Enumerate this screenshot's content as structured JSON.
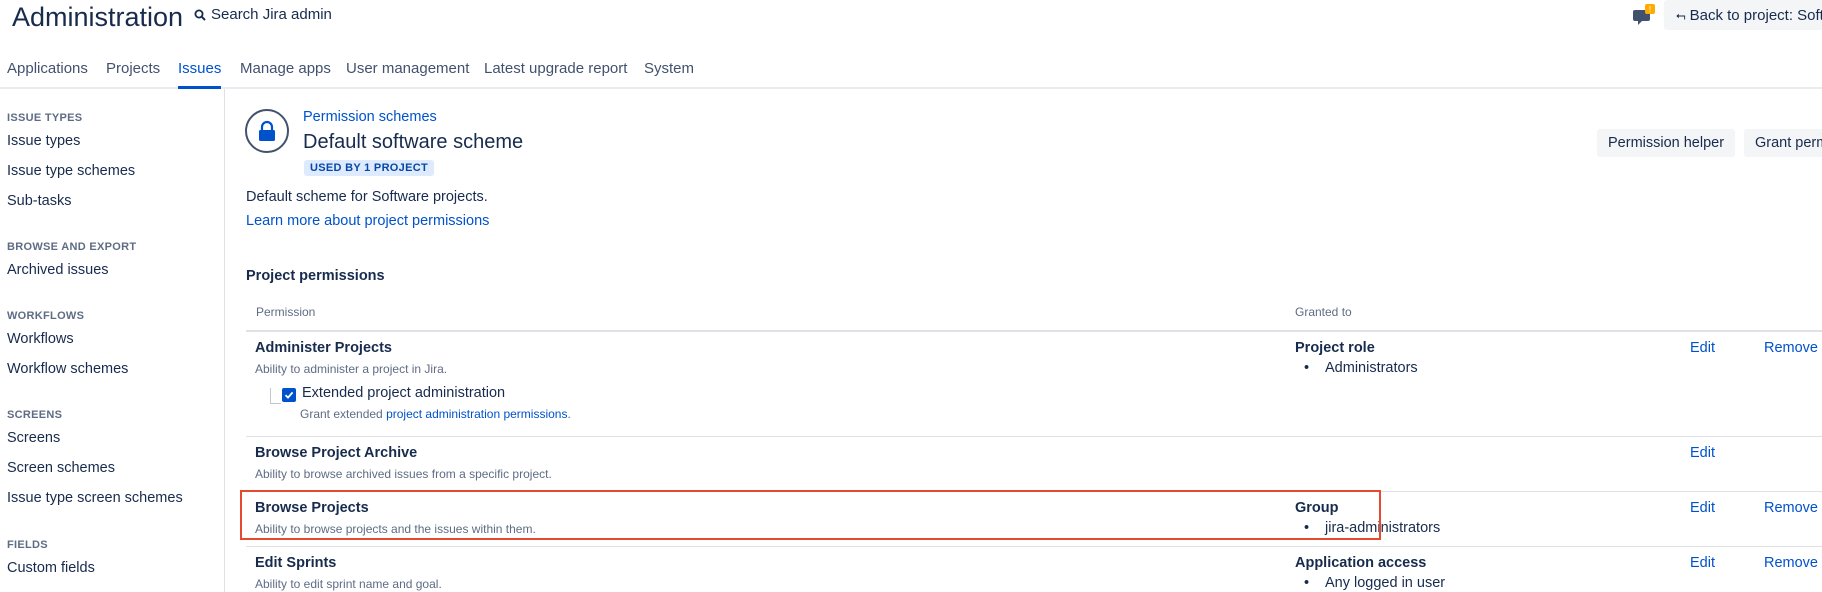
{
  "header": {
    "app_title": "Administration",
    "search_label": "Search Jira admin",
    "back_button": "Back to project: Soft"
  },
  "tabs": [
    {
      "label": "Applications",
      "active": false
    },
    {
      "label": "Projects",
      "active": false
    },
    {
      "label": "Issues",
      "active": true
    },
    {
      "label": "Manage apps",
      "active": false
    },
    {
      "label": "User management",
      "active": false
    },
    {
      "label": "Latest upgrade report",
      "active": false
    },
    {
      "label": "System",
      "active": false
    }
  ],
  "sidebar": {
    "sections": [
      {
        "heading": "ISSUE TYPES",
        "items": [
          "Issue types",
          "Issue type schemes",
          "Sub-tasks"
        ]
      },
      {
        "heading": "BROWSE AND EXPORT",
        "items": [
          "Archived issues"
        ]
      },
      {
        "heading": "WORKFLOWS",
        "items": [
          "Workflows",
          "Workflow schemes"
        ]
      },
      {
        "heading": "SCREENS",
        "items": [
          "Screens",
          "Screen schemes",
          "Issue type screen schemes"
        ]
      },
      {
        "heading": "FIELDS",
        "items": [
          "Custom fields"
        ]
      }
    ]
  },
  "main": {
    "breadcrumb": "Permission schemes",
    "title": "Default software scheme",
    "usage_lozenge": "USED BY 1 PROJECT",
    "permission_helper_button": "Permission helper",
    "grant_button": "Grant perm",
    "description": "Default scheme for Software projects.",
    "learn_more_link": "Learn more about project permissions",
    "section_title": "Project permissions",
    "table": {
      "col_permission": "Permission",
      "col_granted": "Granted to",
      "edit_label": "Edit",
      "remove_label": "Remove",
      "rows": [
        {
          "name": "Administer Projects",
          "description": "Ability to administer a project in Jira.",
          "grant_type": "Project role",
          "grantees": [
            "Administrators"
          ],
          "extended": {
            "label": "Extended project administration",
            "checked": true,
            "desc_prefix": "Grant extended ",
            "desc_link": "project administration permissions",
            "desc_suffix": "."
          }
        },
        {
          "name": "Browse Project Archive",
          "description": "Ability to browse archived issues from a specific project.",
          "grant_type": "",
          "grantees": []
        },
        {
          "name": "Browse Projects",
          "description": "Ability to browse projects and the issues within them.",
          "grant_type": "Group",
          "grantees": [
            "jira-administrators"
          ]
        },
        {
          "name": "Edit Sprints",
          "description": "Ability to edit sprint name and goal.",
          "grant_type": "Application access",
          "grantees": [
            "Any logged in user"
          ]
        }
      ]
    }
  },
  "colors": {
    "link": "#0052cc",
    "text": "#172b4d",
    "subtle": "#5e6c84",
    "highlight_border": "#e34a2f",
    "lozenge_bg": "#deebff",
    "notification_badge": "#ffab00"
  }
}
